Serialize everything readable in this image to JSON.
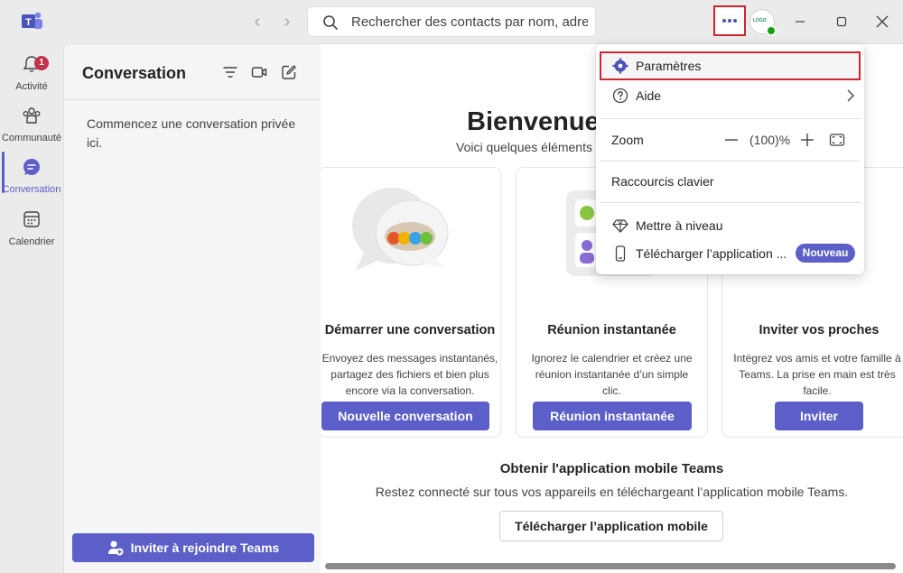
{
  "titlebar": {
    "app_icon": "teams-logo-icon",
    "back_icon": "chevron-left-icon",
    "forward_icon": "chevron-right-icon",
    "search_placeholder": "Rechercher des contacts par nom, adresse",
    "more_icon": "more-horizontal-icon",
    "avatar_text": "LOGO",
    "minimize_icon": "minimize-icon",
    "maximize_icon": "maximize-icon",
    "close_icon": "close-icon"
  },
  "rail": {
    "items": [
      {
        "label": "Activité",
        "icon": "bell-icon",
        "badge": "1"
      },
      {
        "label": "Communauté",
        "icon": "community-icon"
      },
      {
        "label": "Conversation",
        "icon": "chat-icon",
        "active": true
      },
      {
        "label": "Calendrier",
        "icon": "calendar-icon"
      }
    ]
  },
  "chat_panel": {
    "title": "Conversation",
    "empty_text": "Commencez une conversation privée ici.",
    "invite_label": "Inviter à rejoindre Teams"
  },
  "main": {
    "welcome_title": "Bienvenue",
    "welcome_subtitle": "Voici quelques éléments",
    "cards": [
      {
        "title": "Démarrer une conversation",
        "desc": "Envoyez des messages instantanés, partagez des fichiers et bien plus encore via la conversation.",
        "button": "Nouvelle conversation"
      },
      {
        "title": "Réunion instantanée",
        "desc": "Ignorez le calendrier et créez une réunion instantanée d’un simple clic.",
        "button": "Réunion instantanée"
      },
      {
        "title": "Inviter vos proches",
        "desc": "Intégrez vos amis et votre famille à Teams. La prise en main est très facile.",
        "button": "Inviter"
      }
    ],
    "mobile_title": "Obtenir l'application mobile Teams",
    "mobile_desc": "Restez connecté sur tous vos appareils en téléchargeant l’application mobile Teams.",
    "mobile_button": "Télécharger l’application mobile"
  },
  "menu": {
    "settings": "Paramètres",
    "help": "Aide",
    "zoom_label": "Zoom",
    "zoom_value": "(100)%",
    "shortcuts": "Raccourcis clavier",
    "upgrade": "Mettre à niveau",
    "download_app": "Télécharger l’application ...",
    "new_badge": "Nouveau"
  },
  "colors": {
    "accent": "#5b5fc7",
    "highlight_border": "#d02430",
    "badge": "#c4314b",
    "presence": "#13a10e"
  }
}
